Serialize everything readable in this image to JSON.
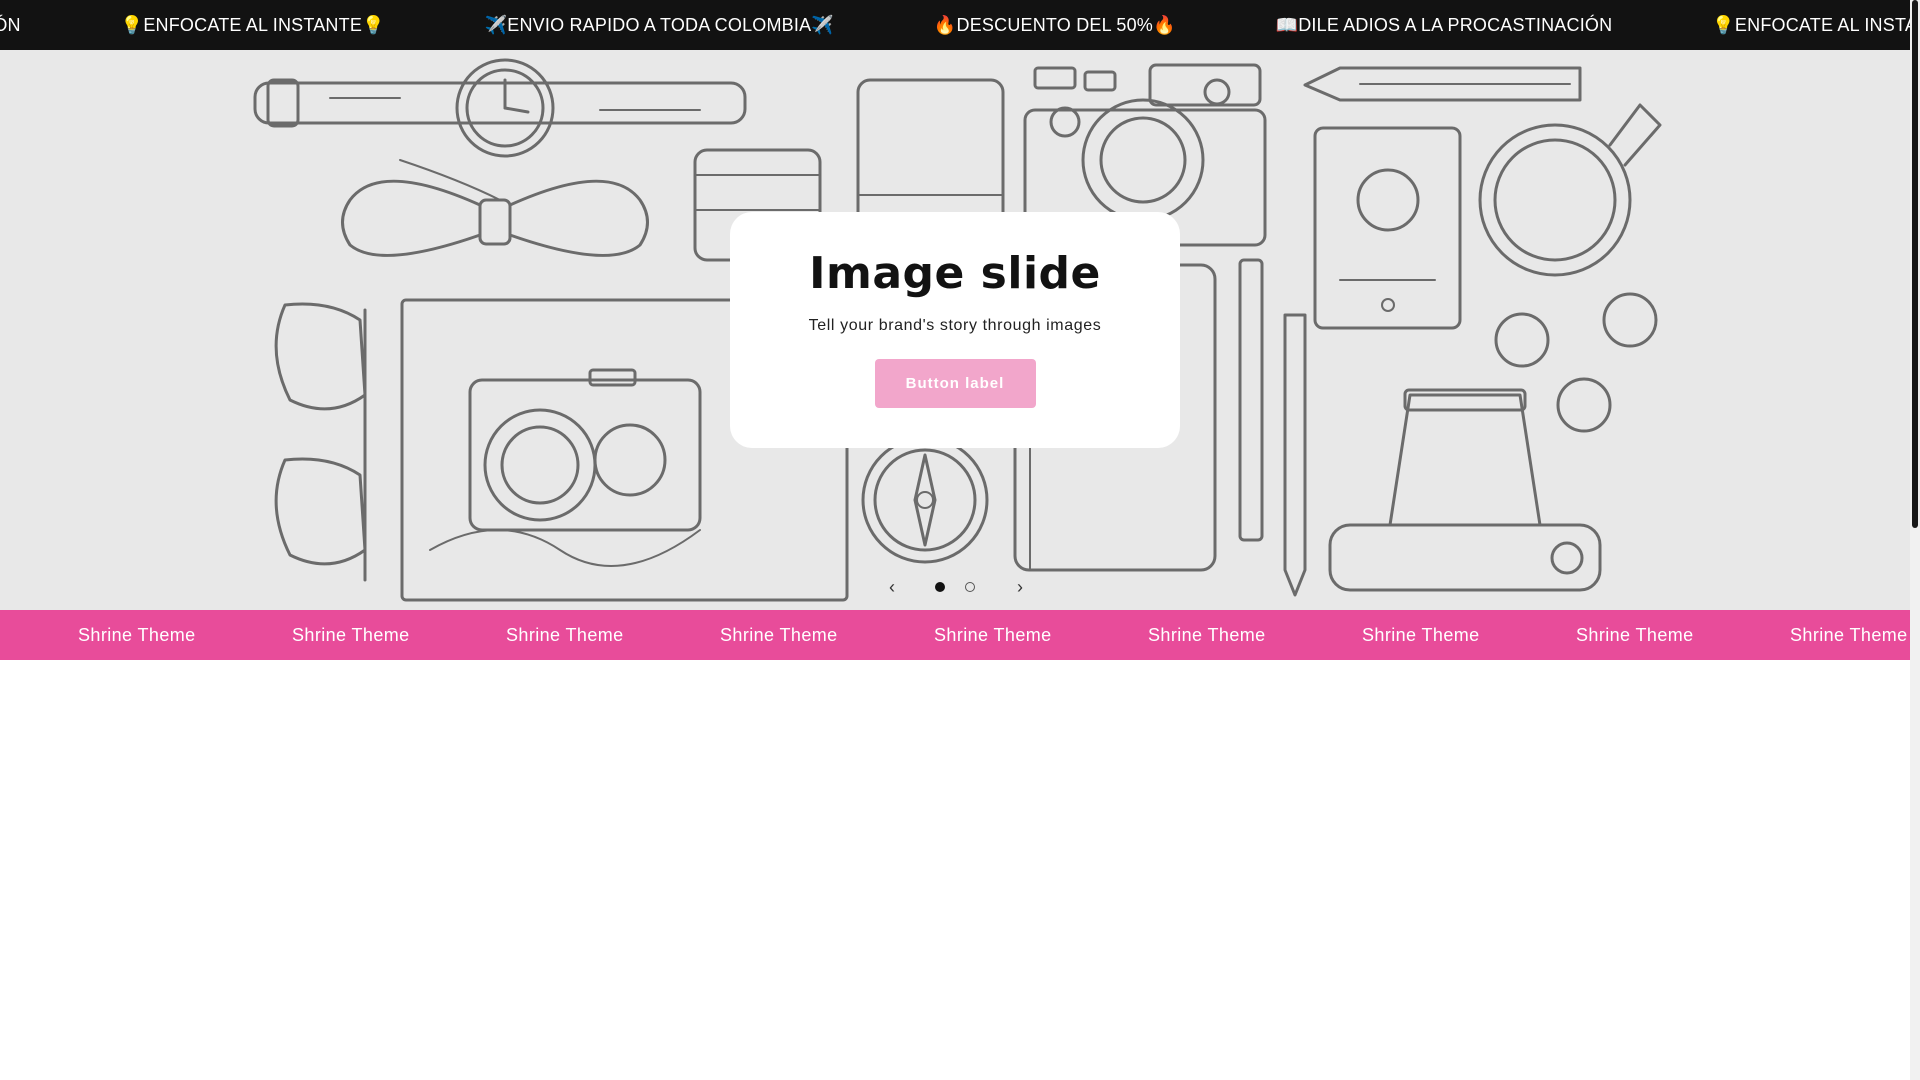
{
  "announcement_bar": {
    "items": [
      "📖DILE ADIOS A LA PROCASTINACIÓN",
      "💡ENFOCATE AL INSTANTE💡",
      "✈️ENVIO RAPIDO A TODA COLOMBIA✈️",
      "🔥DESCUENTO DEL 50%🔥",
      "📖DILE ADIOS A LA PROCASTINACIÓN",
      "💡ENFOCATE AL INSTANTE💡"
    ]
  },
  "slideshow": {
    "title": "Image slide",
    "text": "Tell your brand's story through images",
    "button_label": "Button label",
    "prev_icon": "chevron-left-icon",
    "next_icon": "chevron-right-icon",
    "slide_count": 2,
    "active_slide": 1
  },
  "pink_marquee": {
    "items": [
      "Shrine Theme",
      "Shrine Theme",
      "Shrine Theme",
      "Shrine Theme",
      "Shrine Theme",
      "Shrine Theme",
      "Shrine Theme",
      "Shrine Theme",
      "Shrine Theme"
    ]
  },
  "colors": {
    "announcement_bg": "#121212",
    "hero_bg": "#e8e8e8",
    "button_bg": "#f2a6cb",
    "pink_bar": "#e84c9a"
  }
}
